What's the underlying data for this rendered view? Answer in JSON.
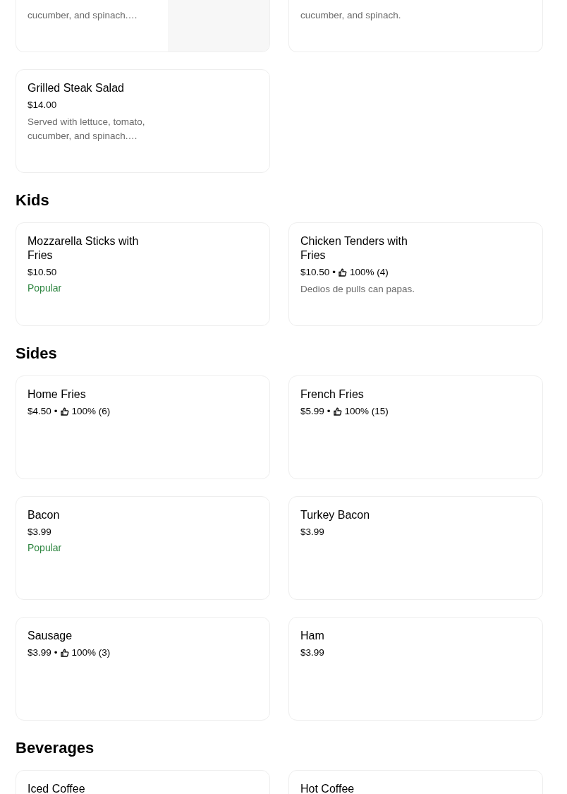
{
  "separator": "•",
  "sections": [
    {
      "items": [
        {
          "kind": "partial",
          "description": "cucumber, and spinach.…",
          "photo": true
        },
        {
          "kind": "partial",
          "description": "cucumber, and spinach."
        },
        {
          "kind": "full",
          "name": "Grilled Steak Salad",
          "price": "$14.00",
          "description": "Served with lettuce, tomato, cucumber, and spinach.…"
        }
      ]
    },
    {
      "title": "Kids",
      "items": [
        {
          "kind": "full",
          "name": "Mozzarella Sticks with Fries",
          "price": "$10.50",
          "badge": "Popular"
        },
        {
          "kind": "full",
          "name": "Chicken Tenders with Fries",
          "price": "$10.50",
          "rating": "100% (4)",
          "description": "Dedios de pulls can papas."
        }
      ]
    },
    {
      "title": "Sides",
      "items": [
        {
          "kind": "full",
          "name": "Home Fries",
          "price": "$4.50",
          "rating": "100% (6)"
        },
        {
          "kind": "full",
          "name": "French Fries",
          "price": "$5.99",
          "rating": "100% (15)"
        },
        {
          "kind": "full",
          "name": "Bacon",
          "price": "$3.99",
          "badge": "Popular"
        },
        {
          "kind": "full",
          "name": "Turkey Bacon",
          "price": "$3.99"
        },
        {
          "kind": "full",
          "name": "Sausage",
          "price": "$3.99",
          "rating": "100% (3)"
        },
        {
          "kind": "full",
          "name": "Ham",
          "price": "$3.99"
        }
      ]
    },
    {
      "title": "Beverages",
      "items": [
        {
          "kind": "full",
          "name": "Iced Coffee"
        },
        {
          "kind": "full",
          "name": "Hot Coffee"
        }
      ]
    }
  ]
}
